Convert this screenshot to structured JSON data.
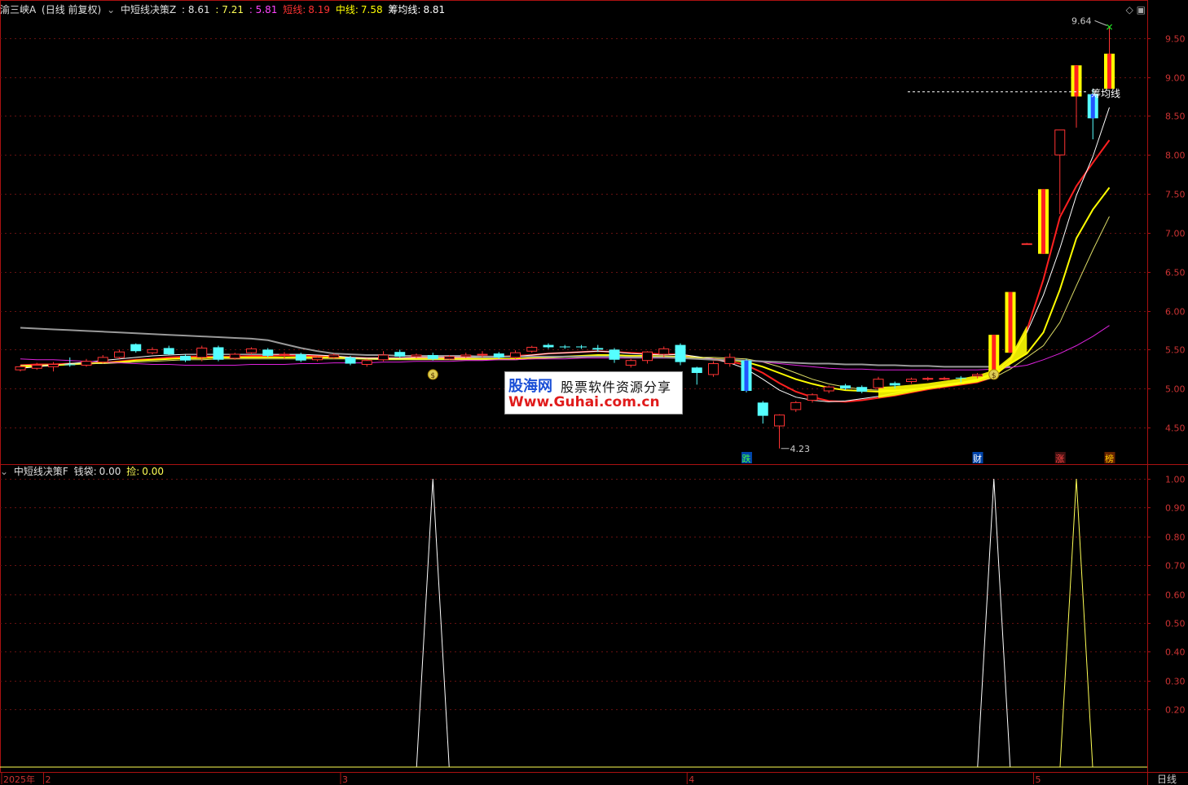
{
  "header_top": {
    "title": "渝三峡A",
    "period": "(日线 前复权)",
    "indicator": "中短线决策Z",
    "v1": ": 8.61",
    "v2": ": 7.21",
    "v3": ": 5.81",
    "short_label": "短线:",
    "short_val": "8.19",
    "mid_label": "中线:",
    "mid_val": "7.58",
    "cost_label": "筹均线:",
    "cost_val": "8.81",
    "colors": {
      "title": "#e0e0e0",
      "v1": "#e0e0e0",
      "v2": "#ffff55",
      "v3": "#ff44ff",
      "short": "#ff3333",
      "mid": "#ffff00",
      "cost": "#ffffff"
    }
  },
  "header_bottom": {
    "indicator": "中短线决策F",
    "bag_label": "钱袋:",
    "bag_val": "0.00",
    "pick_label": "捡:",
    "pick_val": "0.00"
  },
  "watermark": {
    "line1": "股海网",
    "line2": "股票软件资源分享",
    "line3": "Www.Guhai.com.cn"
  },
  "top_icons": "◇ ▣",
  "annotations": {
    "high": "9.64",
    "low": "4.23",
    "cost_line": "筹均线",
    "markers": [
      {
        "text": "跌",
        "color": "#44ff44",
        "bg": "#0044aa",
        "idx": 44
      },
      {
        "text": "财",
        "color": "#ffffff",
        "bg": "#0044aa",
        "idx": 58
      },
      {
        "text": "涨",
        "color": "#ff4444",
        "bg": "#441111",
        "idx": 63
      },
      {
        "text": "榜",
        "color": "#ffcc00",
        "bg": "#662200",
        "idx": 66
      }
    ],
    "money_bags": [
      25,
      59
    ],
    "bag_glyph": "$"
  },
  "x_axis": {
    "labels": [
      {
        "text": "2025年",
        "idx": -1
      },
      {
        "text": "2",
        "idx": 2
      },
      {
        "text": "3",
        "idx": 20
      },
      {
        "text": "4",
        "idx": 41
      },
      {
        "text": "5",
        "idx": 62
      }
    ],
    "period_label": "日线"
  },
  "chart_data": [
    {
      "type": "candlestick",
      "y_ticks": [
        9.5,
        9.0,
        8.5,
        8.0,
        7.5,
        7.0,
        6.5,
        6.0,
        5.5,
        5.0,
        4.5
      ],
      "ylim": [
        4.05,
        9.78
      ],
      "candles": [
        [
          5.24,
          5.28,
          5.22,
          5.3
        ],
        [
          5.26,
          5.3,
          5.24,
          5.33
        ],
        [
          5.28,
          5.31,
          5.22,
          5.34
        ],
        [
          5.31,
          5.3,
          5.28,
          5.4
        ],
        [
          5.3,
          5.35,
          5.28,
          5.38
        ],
        [
          5.34,
          5.4,
          5.32,
          5.43
        ],
        [
          5.4,
          5.47,
          5.38,
          5.5
        ],
        [
          5.57,
          5.48,
          5.46,
          5.58
        ],
        [
          5.46,
          5.5,
          5.44,
          5.53
        ],
        [
          5.52,
          5.44,
          5.43,
          5.55
        ],
        [
          5.42,
          5.36,
          5.34,
          5.44
        ],
        [
          5.4,
          5.52,
          5.35,
          5.55
        ],
        [
          5.53,
          5.37,
          5.35,
          5.55
        ],
        [
          5.39,
          5.44,
          5.37,
          5.46
        ],
        [
          5.46,
          5.51,
          5.44,
          5.53
        ],
        [
          5.5,
          5.42,
          5.4,
          5.52
        ],
        [
          5.43,
          5.44,
          5.38,
          5.47
        ],
        [
          5.44,
          5.36,
          5.34,
          5.46
        ],
        [
          5.37,
          5.4,
          5.35,
          5.42
        ],
        [
          5.4,
          5.43,
          5.38,
          5.45
        ],
        [
          5.4,
          5.32,
          5.3,
          5.42
        ],
        [
          5.31,
          5.36,
          5.28,
          5.38
        ],
        [
          5.37,
          5.43,
          5.35,
          5.48
        ],
        [
          5.47,
          5.41,
          5.4,
          5.5
        ],
        [
          5.41,
          5.43,
          5.39,
          5.45
        ],
        [
          5.43,
          5.38,
          5.36,
          5.46
        ],
        [
          5.38,
          5.41,
          5.37,
          5.43
        ],
        [
          5.41,
          5.43,
          5.39,
          5.46
        ],
        [
          5.44,
          5.44,
          5.4,
          5.48
        ],
        [
          5.45,
          5.4,
          5.38,
          5.47
        ],
        [
          5.4,
          5.46,
          5.38,
          5.49
        ],
        [
          5.48,
          5.53,
          5.46,
          5.55
        ],
        [
          5.56,
          5.53,
          5.51,
          5.58
        ],
        [
          5.54,
          5.53,
          5.51,
          5.56
        ],
        [
          5.54,
          5.53,
          5.51,
          5.56
        ],
        [
          5.52,
          5.5,
          5.47,
          5.56
        ],
        [
          5.5,
          5.37,
          5.33,
          5.52
        ],
        [
          5.3,
          5.36,
          5.27,
          5.38
        ],
        [
          5.36,
          5.47,
          5.32,
          5.48
        ],
        [
          5.44,
          5.51,
          5.4,
          5.54
        ],
        [
          5.56,
          5.34,
          5.3,
          5.58
        ],
        [
          5.27,
          5.2,
          5.05,
          5.28
        ],
        [
          5.18,
          5.32,
          5.15,
          5.35
        ],
        [
          5.32,
          5.4,
          5.28,
          5.45
        ],
        [
          5.36,
          4.97,
          4.95,
          5.38
        ],
        [
          4.82,
          4.65,
          4.55,
          4.84
        ],
        [
          4.52,
          4.66,
          4.23,
          4.67
        ],
        [
          4.73,
          4.82,
          4.7,
          4.84
        ],
        [
          4.85,
          4.92,
          4.82,
          4.94
        ],
        [
          4.97,
          5.02,
          4.94,
          5.04
        ],
        [
          5.04,
          5.0,
          4.98,
          5.06
        ],
        [
          5.02,
          4.96,
          4.94,
          5.04
        ],
        [
          5.01,
          5.12,
          4.99,
          5.15
        ],
        [
          5.07,
          5.04,
          5.0,
          5.09
        ],
        [
          5.09,
          5.12,
          5.06,
          5.14
        ],
        [
          5.12,
          5.13,
          5.1,
          5.15
        ],
        [
          5.13,
          5.13,
          5.11,
          5.15
        ],
        [
          5.14,
          5.13,
          5.08,
          5.16
        ],
        [
          5.16,
          5.18,
          5.13,
          5.2
        ],
        [
          5.17,
          5.69,
          5.16,
          5.69
        ],
        [
          5.46,
          6.24,
          5.46,
          6.24
        ],
        [
          6.86,
          6.86,
          6.86,
          6.87
        ],
        [
          6.73,
          7.56,
          6.73,
          7.56
        ],
        [
          8.0,
          8.32,
          7.24,
          8.32
        ],
        [
          8.75,
          9.15,
          8.35,
          9.15
        ],
        [
          8.78,
          8.47,
          8.2,
          8.85
        ],
        [
          8.85,
          9.3,
          8.85,
          9.64
        ]
      ],
      "colors": {
        "up": "#ff3333",
        "down": "#55ffff",
        "limit_up_fill": "#ffff00"
      }
    },
    {
      "type": "line",
      "series": [
        {
          "color": "#ff2020",
          "width": 2,
          "values": [
            5.3,
            5.31,
            5.31,
            5.32,
            5.32,
            5.33,
            5.35,
            5.37,
            5.38,
            5.4,
            5.41,
            5.41,
            5.41,
            5.41,
            5.42,
            5.42,
            5.43,
            5.42,
            5.42,
            5.41,
            5.4,
            5.39,
            5.39,
            5.39,
            5.4,
            5.4,
            5.4,
            5.4,
            5.41,
            5.41,
            5.42,
            5.43,
            5.45,
            5.46,
            5.47,
            5.48,
            5.47,
            5.46,
            5.45,
            5.44,
            5.44,
            5.4,
            5.37,
            5.35,
            5.3,
            5.2,
            5.07,
            4.96,
            4.89,
            4.84,
            4.83,
            4.85,
            4.88,
            4.91,
            4.95,
            4.99,
            5.02,
            5.05,
            5.08,
            5.15,
            5.35,
            5.75,
            6.4,
            7.2,
            7.6,
            7.9,
            8.19
          ]
        },
        {
          "color": "#ffff00",
          "width": 2,
          "values": [
            5.28,
            5.29,
            5.3,
            5.31,
            5.32,
            5.33,
            5.34,
            5.36,
            5.37,
            5.38,
            5.39,
            5.39,
            5.4,
            5.4,
            5.4,
            5.4,
            5.4,
            5.4,
            5.4,
            5.4,
            5.39,
            5.38,
            5.38,
            5.38,
            5.38,
            5.38,
            5.38,
            5.38,
            5.38,
            5.38,
            5.38,
            5.39,
            5.4,
            5.41,
            5.42,
            5.43,
            5.43,
            5.42,
            5.42,
            5.41,
            5.41,
            5.4,
            5.38,
            5.37,
            5.34,
            5.28,
            5.2,
            5.12,
            5.06,
            5.01,
            4.98,
            4.97,
            4.96,
            4.97,
            4.99,
            5.01,
            5.04,
            5.07,
            5.11,
            5.18,
            5.32,
            5.45,
            5.72,
            6.27,
            6.93,
            7.3,
            7.58
          ]
        },
        {
          "color": "#ffffff",
          "width": 1,
          "values": [
            5.26,
            5.28,
            5.3,
            5.32,
            5.34,
            5.36,
            5.38,
            5.4,
            5.42,
            5.43,
            5.44,
            5.44,
            5.44,
            5.44,
            5.44,
            5.44,
            5.44,
            5.44,
            5.43,
            5.42,
            5.4,
            5.39,
            5.39,
            5.39,
            5.4,
            5.4,
            5.4,
            5.4,
            5.4,
            5.4,
            5.41,
            5.43,
            5.45,
            5.46,
            5.47,
            5.48,
            5.47,
            5.45,
            5.44,
            5.43,
            5.44,
            5.41,
            5.38,
            5.33,
            5.25,
            5.12,
            4.98,
            4.89,
            4.85,
            4.83,
            4.84,
            4.87,
            4.9,
            4.94,
            4.98,
            5.02,
            5.05,
            5.08,
            5.12,
            5.2,
            5.38,
            5.72,
            6.2,
            6.8,
            7.48,
            7.98,
            8.61
          ]
        },
        {
          "color": "#dddd66",
          "width": 1,
          "values": [
            5.3,
            5.3,
            5.31,
            5.31,
            5.32,
            5.32,
            5.33,
            5.34,
            5.35,
            5.36,
            5.37,
            5.37,
            5.38,
            5.38,
            5.38,
            5.38,
            5.38,
            5.38,
            5.38,
            5.38,
            5.38,
            5.38,
            5.37,
            5.37,
            5.37,
            5.37,
            5.37,
            5.37,
            5.37,
            5.37,
            5.37,
            5.38,
            5.39,
            5.4,
            5.4,
            5.41,
            5.41,
            5.41,
            5.41,
            5.41,
            5.41,
            5.4,
            5.4,
            5.39,
            5.38,
            5.34,
            5.28,
            5.2,
            5.12,
            5.06,
            5.02,
            4.99,
            4.98,
            4.98,
            4.99,
            5.01,
            5.03,
            5.06,
            5.09,
            5.14,
            5.25,
            5.4,
            5.55,
            5.85,
            6.32,
            6.78,
            7.21
          ]
        },
        {
          "color": "#dd22dd",
          "width": 1,
          "values": [
            5.38,
            5.37,
            5.37,
            5.36,
            5.35,
            5.34,
            5.33,
            5.32,
            5.31,
            5.31,
            5.3,
            5.3,
            5.3,
            5.3,
            5.31,
            5.31,
            5.31,
            5.32,
            5.32,
            5.33,
            5.33,
            5.33,
            5.34,
            5.34,
            5.35,
            5.35,
            5.35,
            5.36,
            5.36,
            5.37,
            5.37,
            5.38,
            5.38,
            5.38,
            5.39,
            5.39,
            5.39,
            5.39,
            5.39,
            5.39,
            5.39,
            5.38,
            5.38,
            5.37,
            5.36,
            5.34,
            5.32,
            5.3,
            5.28,
            5.26,
            5.25,
            5.25,
            5.24,
            5.24,
            5.24,
            5.24,
            5.24,
            5.24,
            5.24,
            5.25,
            5.27,
            5.3,
            5.37,
            5.45,
            5.55,
            5.67,
            5.81
          ]
        },
        {
          "color": "#999999",
          "width": 2,
          "values": [
            5.78,
            5.77,
            5.76,
            5.75,
            5.74,
            5.73,
            5.72,
            5.71,
            5.7,
            5.69,
            5.68,
            5.67,
            5.66,
            5.65,
            5.64,
            5.62,
            5.57,
            5.52,
            5.48,
            5.45,
            5.44,
            5.43,
            5.43,
            5.42,
            5.42,
            5.42,
            5.42,
            5.42,
            5.41,
            5.41,
            5.41,
            5.41,
            5.41,
            5.41,
            5.41,
            5.41,
            5.41,
            5.4,
            5.4,
            5.4,
            5.39,
            5.38,
            5.37,
            5.37,
            5.36,
            5.35,
            5.34,
            5.33,
            5.32,
            5.32,
            5.31,
            5.31,
            5.3,
            5.3,
            5.29,
            5.29,
            5.28,
            5.28,
            5.28,
            5.28,
            5.28,
            null,
            null,
            null,
            null,
            null,
            null
          ]
        }
      ],
      "cost_line_value": 8.81
    },
    {
      "type": "line",
      "y_ticks": [
        1.0,
        0.9,
        0.8,
        0.7,
        0.6,
        0.5,
        0.4,
        0.3,
        0.2
      ],
      "ylim": [
        0,
        1.0
      ],
      "series": [
        {
          "name": "钱袋",
          "color": "#ffffff",
          "spikes": [
            25,
            59
          ]
        },
        {
          "name": "捡",
          "color": "#ffff55",
          "spikes": [
            64
          ]
        }
      ]
    }
  ]
}
